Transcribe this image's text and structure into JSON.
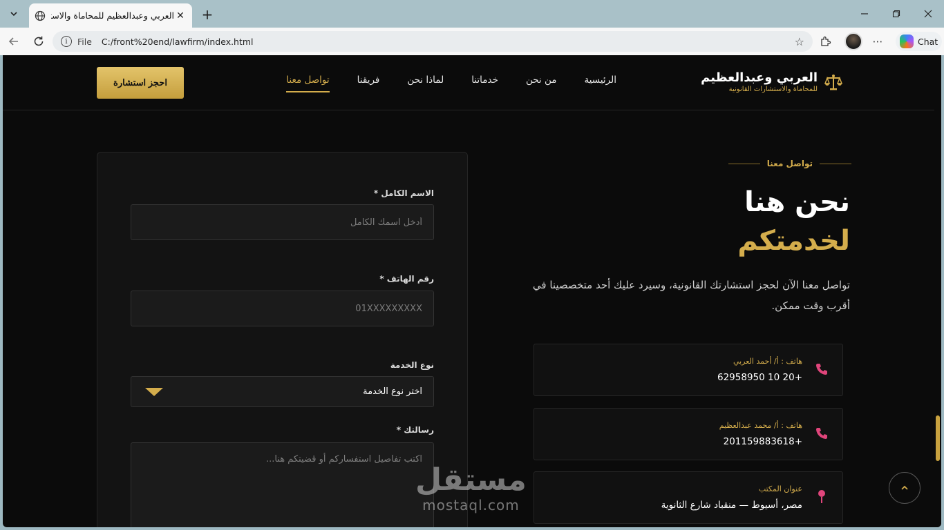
{
  "browser": {
    "tab_title": "العربي وعبدالعظيم للمحاماة والاستش",
    "scheme": "File",
    "url": "C:/front%20end/lawfirm/index.html",
    "copilot_label": "Chat"
  },
  "header": {
    "brand_name": "العربي وعبدالعظيم",
    "brand_tagline": "للمحاماة والاستشارات القانونية",
    "nav": [
      {
        "label": "الرئيسية"
      },
      {
        "label": "من نحن"
      },
      {
        "label": "خدماتنا"
      },
      {
        "label": "لماذا نحن"
      },
      {
        "label": "فريقنا"
      },
      {
        "label": "تواصل معنا"
      }
    ],
    "active_nav": "تواصل معنا",
    "cta_label": "احجز استشارة"
  },
  "contact": {
    "eyebrow": "تواصل معنا",
    "heading_line1": "نحن هنا",
    "heading_line2": "لخدمتكم",
    "lead": "تواصل معنا الآن لحجز استشارتك القانونية، وسيرد عليك أحد متخصصينا في أقرب وقت ممكن.",
    "cards": [
      {
        "label": "هاتف : أ/ أحمد العربي",
        "value": "+20 10 62958950",
        "icon": "phone-icon"
      },
      {
        "label": "هاتف : أ/ محمد عبدالعظيم",
        "value": "+201159883618",
        "icon": "phone-icon"
      },
      {
        "label": "عنوان المكتب",
        "value": "مصر، أسيوط — منقباد شارع الثانوية",
        "icon": "map-pin-icon"
      }
    ]
  },
  "form": {
    "name_label": "الاسم الكامل *",
    "name_placeholder": "أدخل اسمك الكامل",
    "phone_label": "رقم الهاتف *",
    "phone_placeholder": "01XXXXXXXXX",
    "service_label": "نوع الخدمة",
    "service_value": "اختر نوع الخدمة",
    "message_label": "رسالتك *",
    "message_placeholder": "اكتب تفاصيل استفساركم أو قضيتكم هنا..."
  },
  "watermark": {
    "arabic": "مستقل",
    "latin": "mostaql.com"
  },
  "colors": {
    "accent_gold": "#d4ad4c",
    "phone_icon": "#e0457b",
    "page_bg": "#0b0b0b"
  }
}
